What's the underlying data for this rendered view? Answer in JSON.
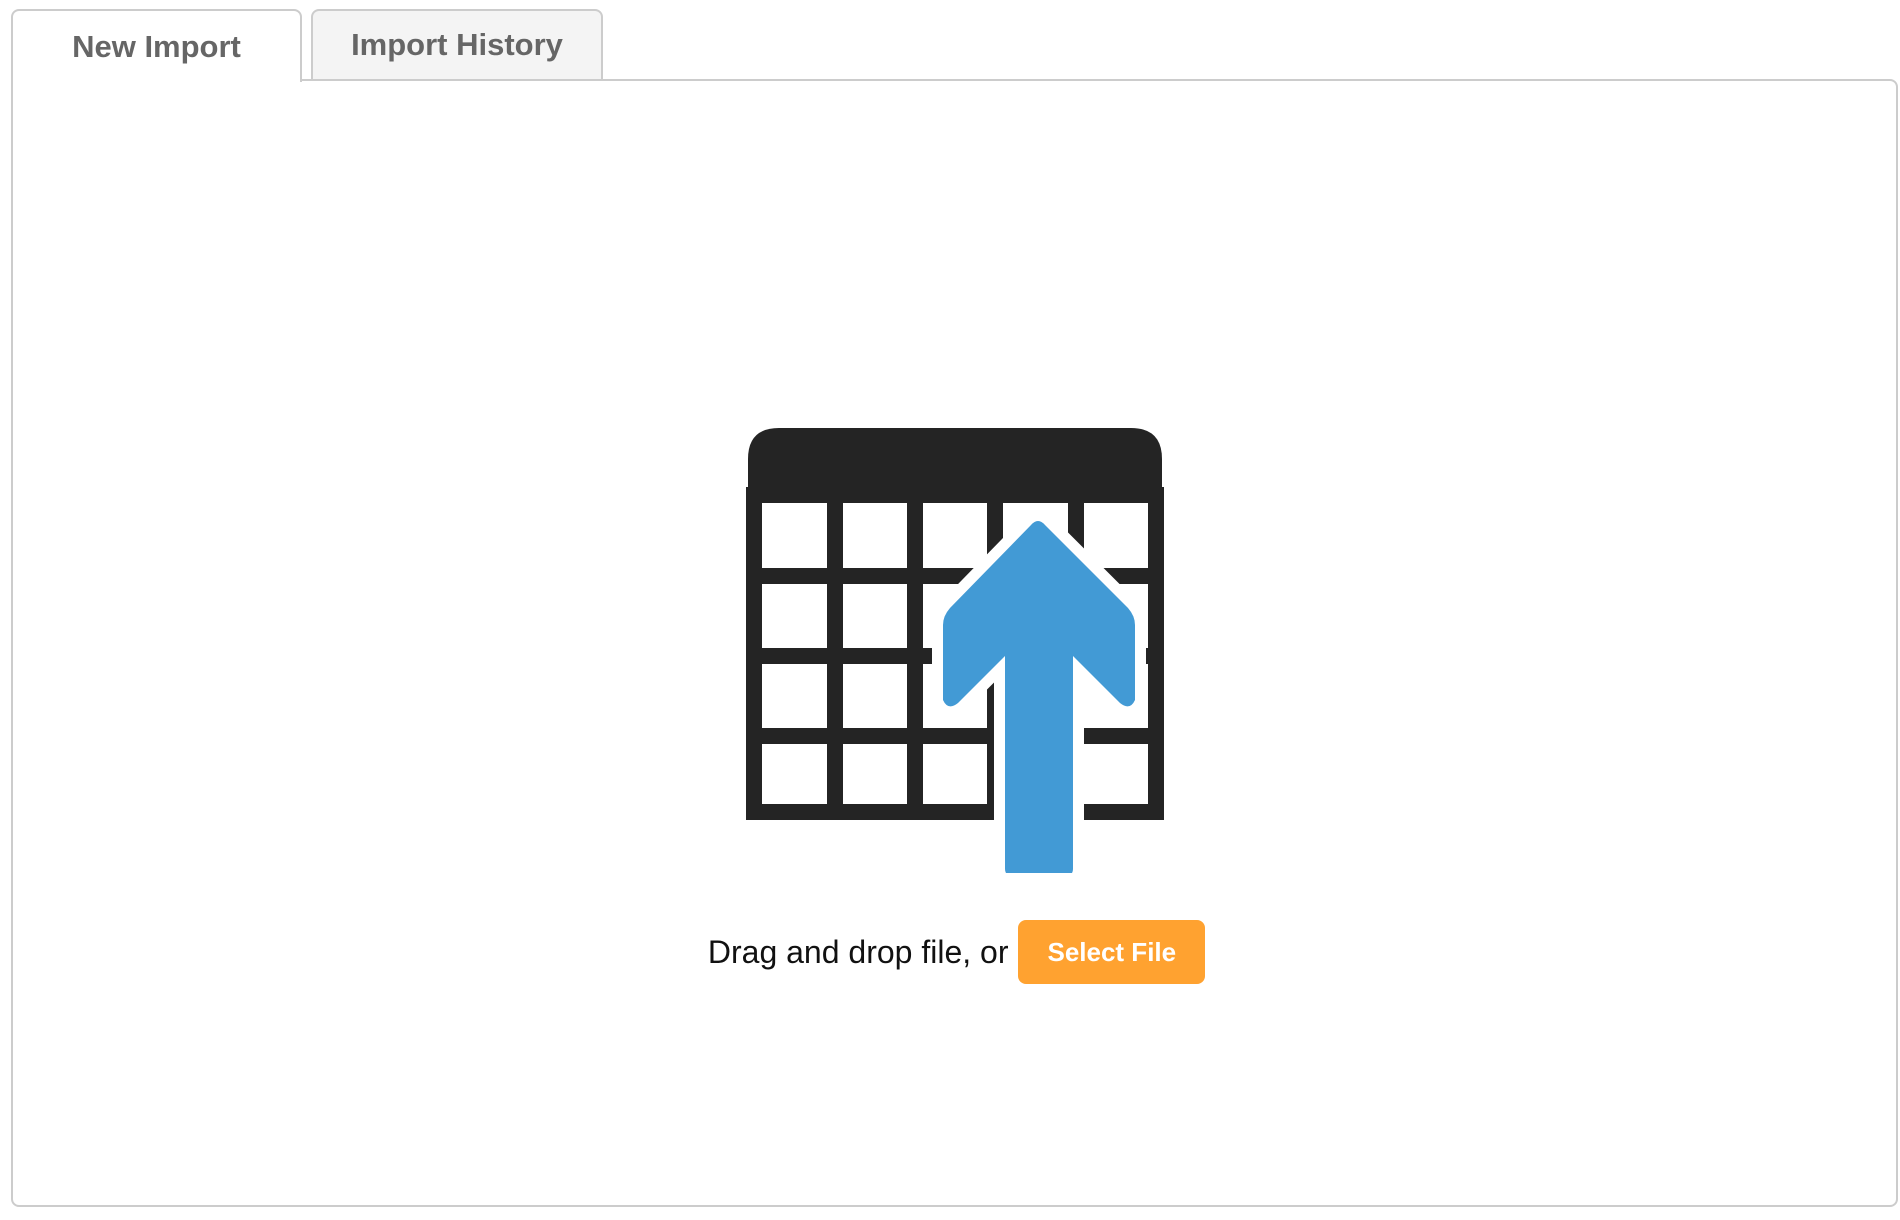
{
  "tabs": [
    {
      "label": "New Import",
      "active": true
    },
    {
      "label": "Import History",
      "active": false
    }
  ],
  "dropzone": {
    "icon": "spreadsheet-upload-icon",
    "prompt": "Drag and drop file, or",
    "button_label": "Select File"
  },
  "colors": {
    "accent": "#ffa230",
    "arrow": "#429ad5",
    "grid": "#242424",
    "tab_text": "#666666",
    "border": "#cccccc"
  }
}
